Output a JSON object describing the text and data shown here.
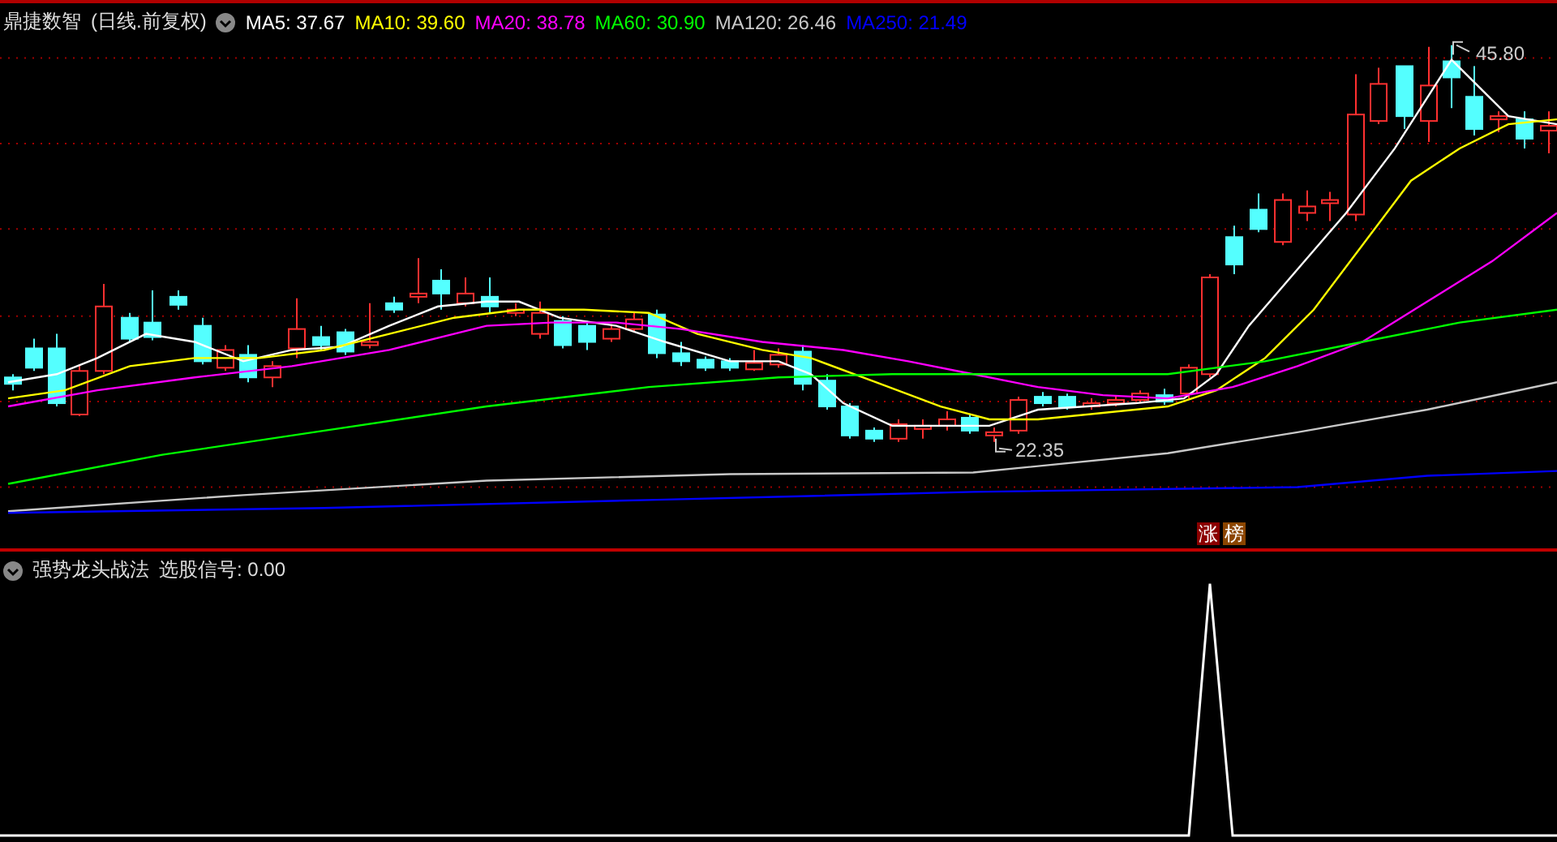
{
  "main_panel": {
    "title": "鼎捷数智",
    "period": "(日线.前复权)",
    "ma": [
      {
        "label": "MA5: 37.67",
        "color": "#ffffff"
      },
      {
        "label": "MA10: 39.60",
        "color": "#ffff00"
      },
      {
        "label": "MA20: 38.78",
        "color": "#ff00ff"
      },
      {
        "label": "MA60: 30.90",
        "color": "#00ff00"
      },
      {
        "label": "MA120: 26.46",
        "color": "#c8c8c8"
      },
      {
        "label": "MA250: 21.49",
        "color": "#0000ff"
      }
    ],
    "high_label": "45.80",
    "low_label": "22.35",
    "badges": [
      {
        "text": "涨",
        "color": "#8b0000"
      },
      {
        "text": "榜",
        "color": "#8b4500"
      }
    ]
  },
  "indicator_panel": {
    "title": "强势龙头战法",
    "signal": "选股信号: 0.00"
  }
}
